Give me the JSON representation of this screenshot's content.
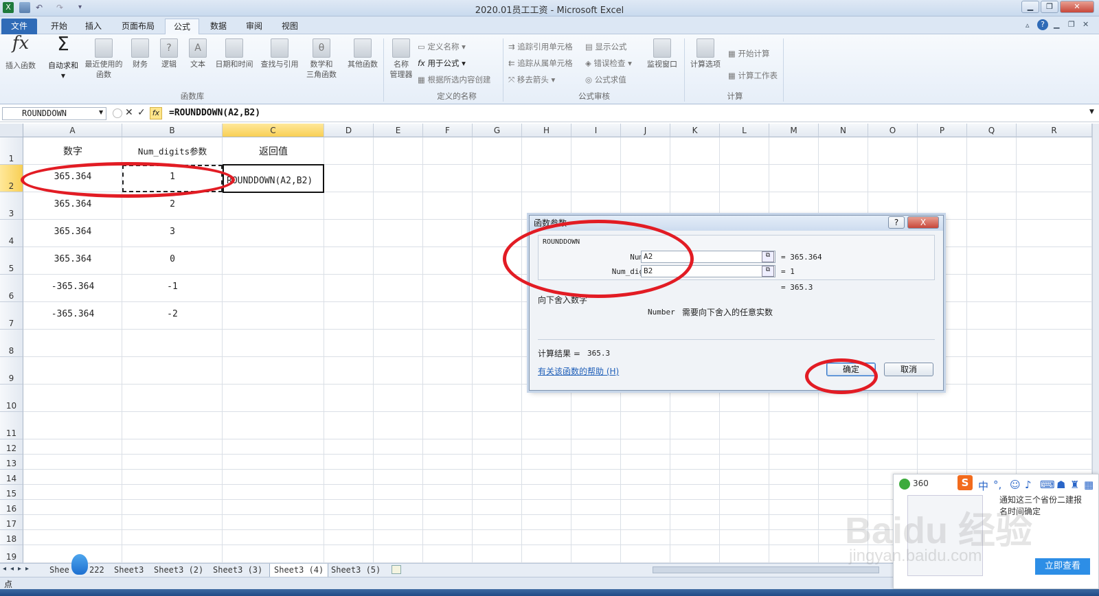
{
  "window": {
    "title": "2020.01员工工资 - Microsoft Excel"
  },
  "tabs": [
    "文件",
    "开始",
    "插入",
    "页面布局",
    "公式",
    "数据",
    "审阅",
    "视图"
  ],
  "ribbon": {
    "insert_fn": "插入函数",
    "autosum": "自动求和",
    "recent_1": "最近使用的",
    "recent_2": "函数",
    "finance": "财务",
    "logic": "逻辑",
    "text": "文本",
    "datetime": "日期和时间",
    "lookup": "查找与引用",
    "math_1": "数学和",
    "math_2": "三角函数",
    "other": "其他函数",
    "group_library": "函数库",
    "name_mgr_1": "名称",
    "name_mgr_2": "管理器",
    "define_name": "定义名称",
    "use_in_formula": "用于公式",
    "create_from_sel": "根据所选内容创建",
    "group_names": "定义的名称",
    "trace_prec": "追踪引用单元格",
    "trace_dep": "追踪从属单元格",
    "remove_arrows": "移去箭头",
    "show_formulas": "显示公式",
    "error_check": "错误检查",
    "eval_formula": "公式求值",
    "group_audit": "公式审核",
    "watch": "监视窗口",
    "calc_opts": "计算选项",
    "calc_now": "开始计算",
    "calc_sheet": "计算工作表",
    "group_calc": "计算"
  },
  "formula_bar": {
    "name_box": "ROUNDDOWN",
    "formula": "=ROUNDDOWN(A2,B2)"
  },
  "columns": [
    "A",
    "B",
    "C",
    "D",
    "E",
    "F",
    "G",
    "H",
    "I",
    "J",
    "K",
    "L",
    "M",
    "N",
    "O",
    "P",
    "Q",
    "R"
  ],
  "rows": [
    "1",
    "2",
    "3",
    "4",
    "5",
    "6",
    "7",
    "8",
    "9",
    "10",
    "11",
    "12",
    "13",
    "14",
    "15",
    "16",
    "17",
    "18",
    "19"
  ],
  "cells": {
    "A1": "数字",
    "B1": "Num_digits参数",
    "C1": "返回值",
    "A2": "365.364",
    "B2": "1",
    "C2": "ROUNDDOWN(A2,B2)",
    "A3": "365.364",
    "B3": "2",
    "A4": "365.364",
    "B4": "3",
    "A5": "365.364",
    "B5": "0",
    "A6": "-365.364",
    "B6": "-1",
    "A7": "-365.364",
    "B7": "-2"
  },
  "dialog": {
    "title": "函数参数",
    "function_name": "ROUNDDOWN",
    "arg1_label": "Number",
    "arg1_value": "A2",
    "arg1_result": "= 365.364",
    "arg2_label": "Num_digits",
    "arg2_value": "B2",
    "arg2_result": "= 1",
    "formula_result": "= 365.3",
    "description": "向下舍入数字",
    "arg_help_name": "Number",
    "arg_help_text": "需要向下舍入的任意实数",
    "calc_result_label": "计算结果 =",
    "calc_result_value": "365.3",
    "help_link": "有关该函数的帮助 (H)",
    "ok": "确定",
    "cancel": "取消",
    "help_btn": "?",
    "close_btn": "X"
  },
  "sheet_tabs": [
    "Shee",
    "222",
    "Sheet3",
    "Sheet3 (2)",
    "Sheet3 (3)",
    "Sheet3 (4)",
    "Sheet3 (5)"
  ],
  "status": {
    "mode": "点"
  },
  "popup": {
    "brand": "360",
    "text1": "通知这三个省份二建报",
    "text2": "名时间确定",
    "button": "立即查看",
    "ime_lang": "中"
  },
  "watermark": {
    "text1": "Baidu 经验",
    "text2": "jingyan.baidu.com"
  },
  "colors": {
    "accent": "#2f6bb7",
    "highlight_oval": "#e21c24",
    "selection_header": "#f8cf55"
  }
}
